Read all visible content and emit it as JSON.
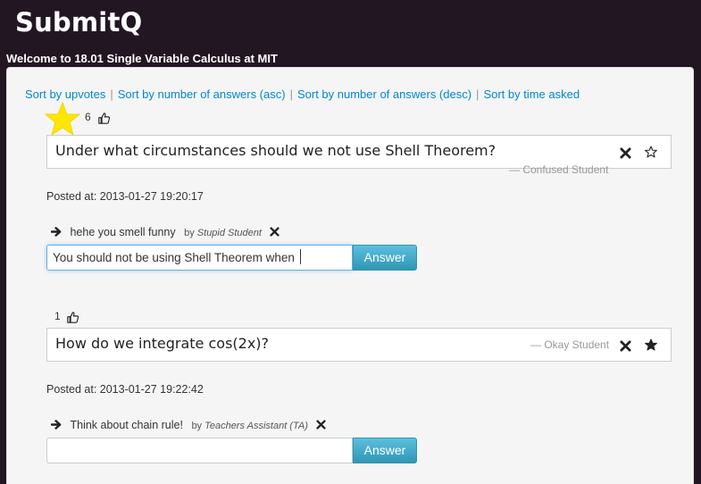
{
  "header": {
    "app_title": "SubmitQ",
    "welcome": "Welcome to 18.01 Single Variable Calculus at MIT"
  },
  "sort": {
    "by_upvotes": "Sort by upvotes",
    "by_answers_asc": "Sort by number of answers (asc)",
    "by_answers_desc": "Sort by number of answers (desc)",
    "by_time": "Sort by time asked",
    "separator": "|"
  },
  "questions": [
    {
      "upvotes": "6",
      "starred_highlight": true,
      "text": "Under what circumstances should we not use Shell Theorem?",
      "author": "— Confused Student",
      "favorited": false,
      "posted": "Posted at: 2013-01-27 19:20:17",
      "answer": {
        "text": "hehe you smell funny",
        "by": "by",
        "author": "Stupid Student"
      },
      "input": {
        "value": "You should not be using Shell Theorem when",
        "placeholder": ""
      },
      "answer_button": "Answer"
    },
    {
      "upvotes": "1",
      "starred_highlight": false,
      "text": "How do we integrate cos(2x)?",
      "author": "— Okay Student",
      "favorited": true,
      "posted": "Posted at: 2013-01-27 19:22:42",
      "answer": {
        "text": "Think about chain rule!",
        "by": "by",
        "author": "Teachers Assistant (TA)"
      },
      "input": {
        "value": "",
        "placeholder": ""
      },
      "answer_button": "Answer"
    }
  ],
  "icons": {
    "thumb": "thumbs-up-icon",
    "close": "close-icon",
    "star": "star-icon",
    "arrow": "arrow-right-icon"
  },
  "colors": {
    "header_bg": "#231623",
    "link": "#0088cc",
    "highlight_star": "#ffe600",
    "button": "#49afcd"
  }
}
